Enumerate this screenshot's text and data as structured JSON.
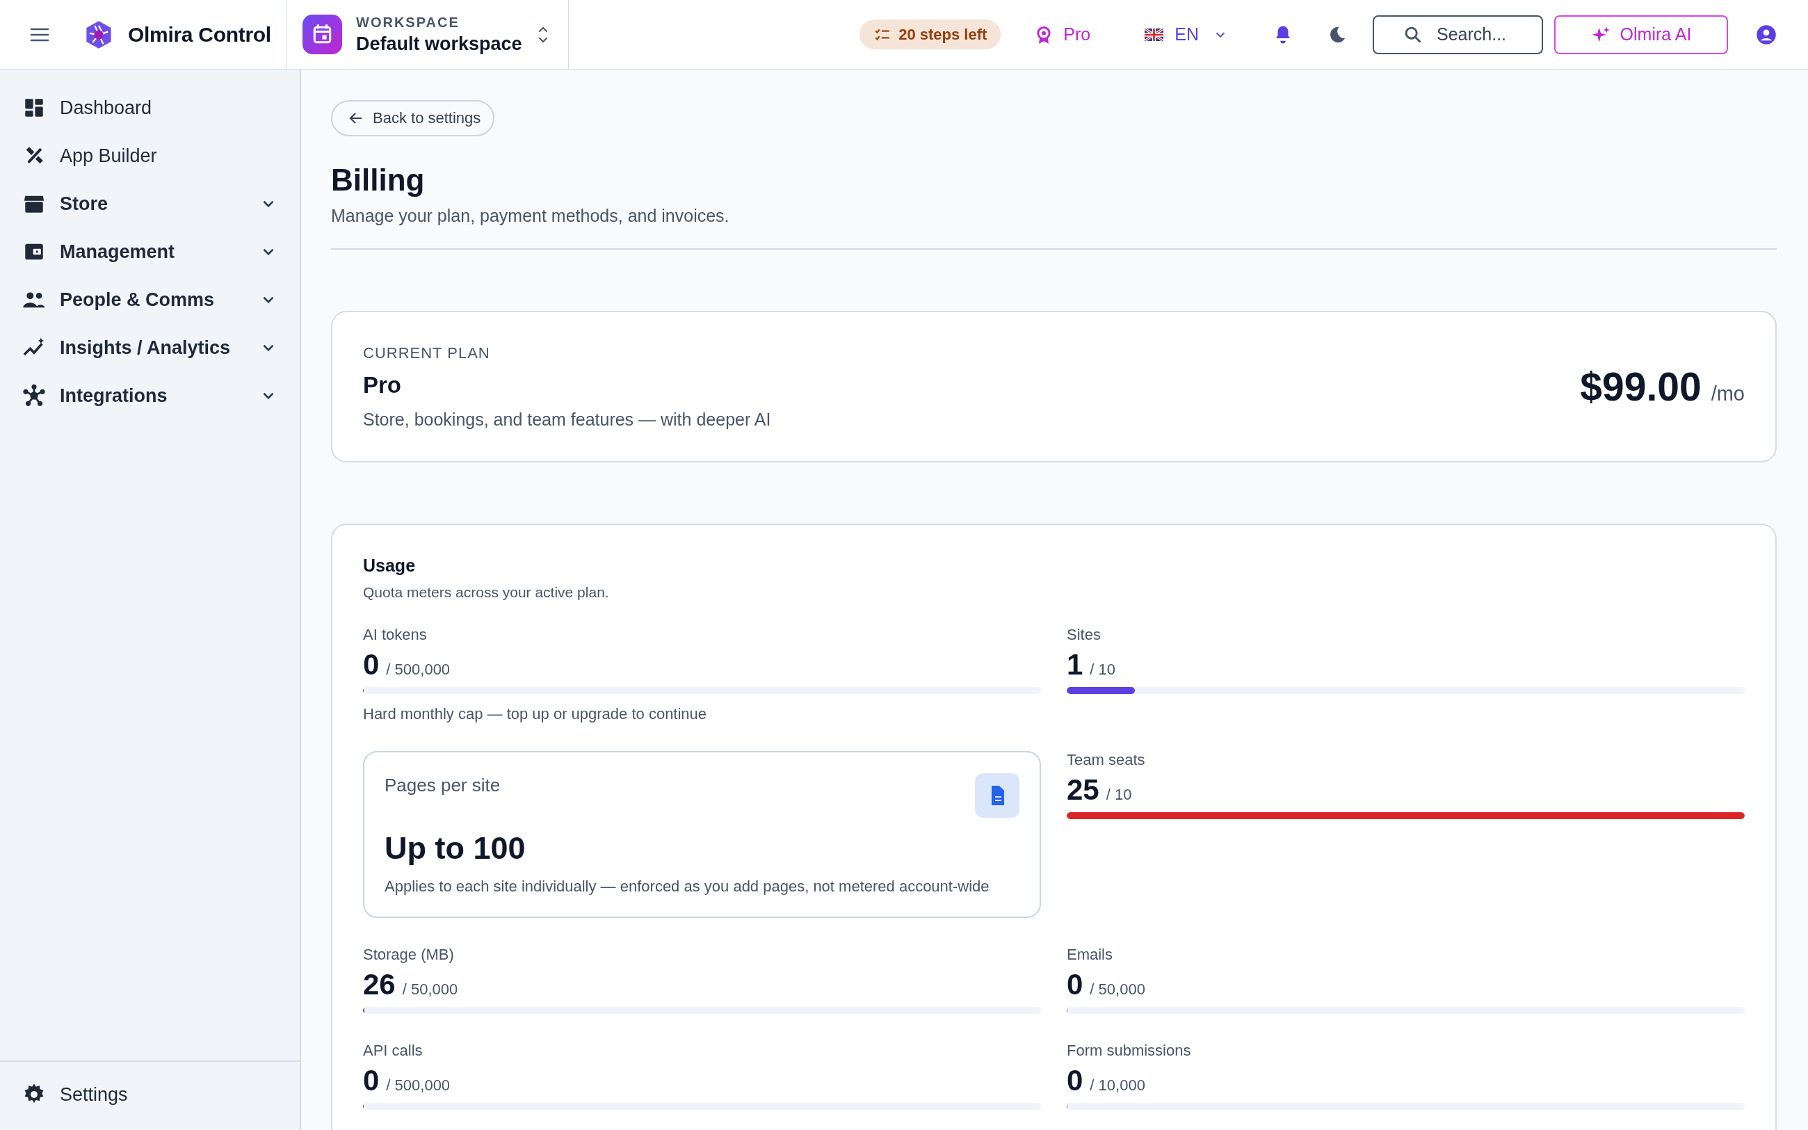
{
  "topbar": {
    "brand": "Olmira Control",
    "workspace": {
      "label": "WORKSPACE",
      "name": "Default workspace"
    },
    "steps": "20 steps left",
    "plan_badge": "Pro",
    "language": "EN",
    "search": {
      "placeholder": "Search..."
    },
    "ai_button": "Olmira AI"
  },
  "sidebar": {
    "items": [
      {
        "label": "Dashboard",
        "expandable": false
      },
      {
        "label": "App Builder",
        "expandable": false
      },
      {
        "label": "Store",
        "expandable": true
      },
      {
        "label": "Management",
        "expandable": true
      },
      {
        "label": "People & Comms",
        "expandable": true
      },
      {
        "label": "Insights / Analytics",
        "expandable": true
      },
      {
        "label": "Integrations",
        "expandable": true
      }
    ],
    "footer": {
      "label": "Settings"
    }
  },
  "back_link": "Back to settings",
  "page": {
    "title": "Billing",
    "subtitle": "Manage your plan, payment methods, and invoices."
  },
  "current_plan": {
    "label": "CURRENT PLAN",
    "name": "Pro",
    "description": "Store, bookings, and team features — with deeper AI",
    "price": "$99.00",
    "period": "/mo"
  },
  "usage": {
    "title": "Usage",
    "subtitle": "Quota meters across your active plan.",
    "items": [
      {
        "kind": "meter",
        "label": "AI tokens",
        "value": "0",
        "limit": "/ 500,000",
        "level": 0,
        "note": "Hard monthly cap — top up or upgrade to continue"
      },
      {
        "kind": "meter",
        "label": "Sites",
        "value": "1",
        "limit": "/ 10",
        "level": 0.1
      },
      {
        "kind": "card",
        "title": "Pages per site",
        "value": "Up to 100",
        "description": "Applies to each site individually — enforced as you add pages, not metered account-wide"
      },
      {
        "kind": "meter",
        "label": "Team seats",
        "value": "25",
        "limit": "/ 10",
        "level": 1,
        "over_limit": true
      },
      {
        "kind": "meter",
        "label": "Storage (MB)",
        "value": "26",
        "limit": "/ 50,000",
        "level": 0.002
      },
      {
        "kind": "meter",
        "label": "Emails",
        "value": "0",
        "limit": "/ 50,000",
        "level": 0
      },
      {
        "kind": "meter",
        "label": "API calls",
        "value": "0",
        "limit": "/ 500,000",
        "level": 0
      },
      {
        "kind": "meter",
        "label": "Form submissions",
        "value": "0",
        "limit": "/ 10,000",
        "level": 0
      }
    ]
  }
}
